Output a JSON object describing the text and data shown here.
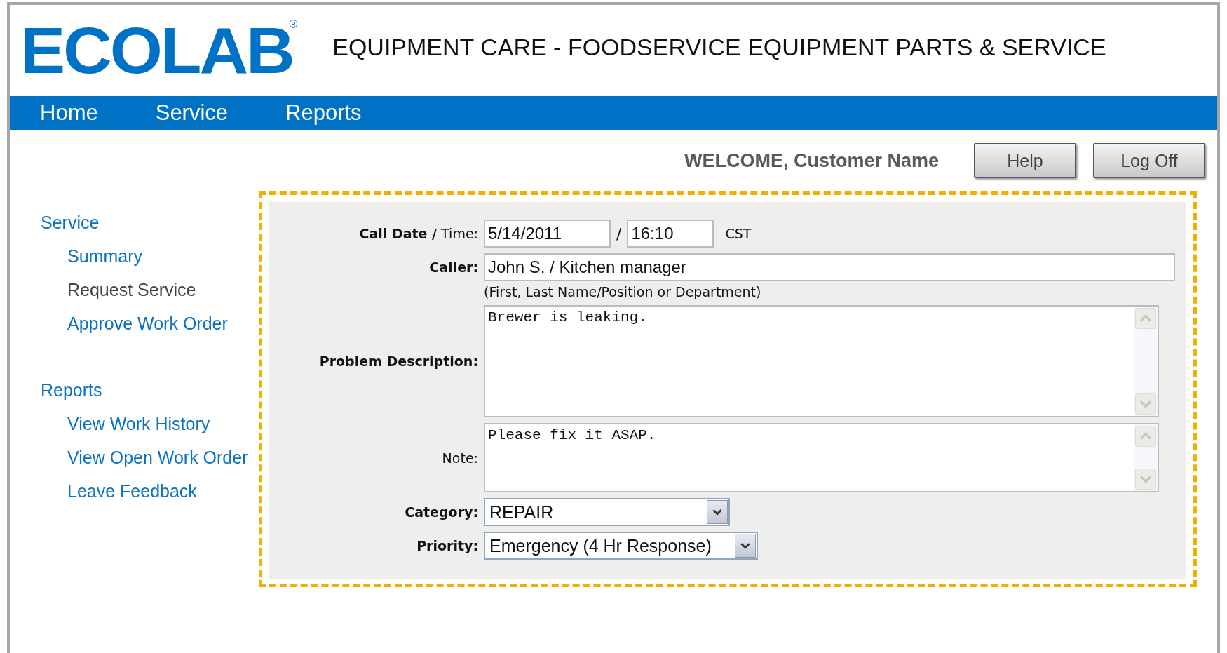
{
  "logo": {
    "text": "ECOLAB",
    "mark": "®"
  },
  "header_title": "EQUIPMENT CARE - FOODSERVICE EQUIPMENT PARTS & SERVICE",
  "nav": [
    {
      "label": "Home"
    },
    {
      "label": "Service"
    },
    {
      "label": "Reports"
    }
  ],
  "welcome": "WELCOME, Customer Name",
  "buttons": [
    "Help",
    "Log Off"
  ],
  "sidebar": [
    {
      "label": "Service",
      "selected": false,
      "children": [
        {
          "label": "Summary",
          "selected": false
        },
        {
          "label": "Request Service",
          "selected": true
        },
        {
          "label": "Approve Work Order",
          "selected": false
        }
      ]
    },
    {
      "label": "Reports",
      "selected": false,
      "children": [
        {
          "label": "View Work History",
          "selected": false
        },
        {
          "label": "View Open Work Order",
          "selected": false
        },
        {
          "label": "Leave Feedback",
          "selected": false
        }
      ]
    }
  ],
  "form": {
    "call_date": {
      "label": "**Call Date /** Time:",
      "date": "5/14/2011",
      "separator": "/",
      "time": "16:10",
      "zone": "CST"
    },
    "caller": {
      "label": "Caller:",
      "value": "John S. / Kitchen manager",
      "hint": "(First, Last Name/Position or Department)"
    },
    "problem": {
      "label": "Problem Description:",
      "value": "Brewer is leaking."
    },
    "note": {
      "label": "Note:",
      "value": "Please fix it ASAP."
    },
    "category": {
      "label": "Category:",
      "value": "REPAIR"
    },
    "priority": {
      "label": "Priority:",
      "value": "Emergency (4 Hr Response)"
    }
  }
}
